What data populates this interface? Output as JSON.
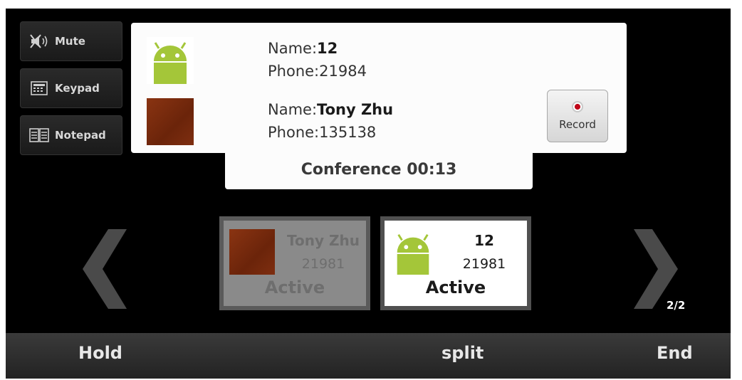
{
  "side_buttons": {
    "mute": "Mute",
    "keypad": "Keypad",
    "notepad": "Notepad"
  },
  "conference": {
    "participants": [
      {
        "name_label": "Name:",
        "name": "12",
        "phone": "Phone:21984"
      },
      {
        "name_label": "Name:",
        "name": "Tony Zhu",
        "phone": "Phone:135138"
      }
    ],
    "record_label": "Record",
    "status": "Conference 00:13"
  },
  "calls": [
    {
      "name": "Tony Zhu",
      "number": "21981",
      "status": "Active"
    },
    {
      "name": "12",
      "number": "21981",
      "status": "Active"
    }
  ],
  "page_indicator": "2/2",
  "bottom_bar": {
    "hold": "Hold",
    "split": "split",
    "end": "End"
  },
  "colors": {
    "background": "#000000",
    "panel": "#fcfcfc",
    "record_dot": "#c0081a",
    "android_green": "#a4c639"
  }
}
